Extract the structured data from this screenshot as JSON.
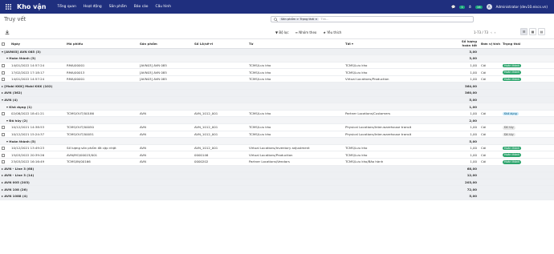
{
  "topbar": {
    "app_name": "Kho vận",
    "menu": [
      "Tổng quan",
      "Hoạt động",
      "Sản phẩm",
      "Báo cáo",
      "Cấu hình"
    ],
    "chat_count": "1",
    "activity_count": "14",
    "user": "Administrator (dev10.eiscs.vn)"
  },
  "control": {
    "title": "Truy vết",
    "search_facet": "Sản phẩm > Trạng thái",
    "search_placeholder": "Tìm...",
    "filters_label": "Bộ lọc",
    "groupby_label": "Nhóm theo",
    "favorites_label": "Yêu thích",
    "pager": "1-73 / 73"
  },
  "columns": [
    "Ngày",
    "Mã phiếu",
    "Sản phẩm",
    "Số Lô/sê-ri",
    "Từ",
    "Tới",
    "Số lượng hoàn tất",
    "Đơn vị tính",
    "Trạng thái"
  ],
  "rows": [
    {
      "kind": "g1",
      "label": "▾ [AVN03] AVN 085 (3)",
      "qty": "3,00"
    },
    {
      "kind": "g2",
      "label": "▾ Hoàn thành (3)",
      "qty": "3,00"
    },
    {
      "kind": "r",
      "date": "14/01/2022 14:57:24",
      "ref": "RMA/00001",
      "product": "[AVN03] AVN 085",
      "lot": "",
      "from": "TCMS/Lưu kho",
      "to": "TCMS/Lưu kho",
      "qty": "1,00",
      "uom": "Cái",
      "status": "Hoàn thành",
      "tone": "green"
    },
    {
      "kind": "r",
      "date": "17/02/2022 17:18:17",
      "ref": "RMA/00013",
      "product": "[AVN03] AVN 085",
      "lot": "",
      "from": "TCMS/Lưu kho",
      "to": "TCMS/Lưu kho",
      "qty": "1,00",
      "uom": "Cái",
      "status": "Hoàn thành",
      "tone": "green"
    },
    {
      "kind": "r",
      "date": "14/01/2022 14:57:24",
      "ref": "RMA/00001",
      "product": "[AVN03] AVN 085",
      "lot": "",
      "from": "TCMS/Lưu kho",
      "to": "Virtual Locations/Production",
      "qty": "1,00",
      "uom": "Cái",
      "status": "Hoàn thành",
      "tone": "green"
    },
    {
      "kind": "g1",
      "label": "▸ [Mobi KKK] Mobi KKK (102)",
      "qty": "364,00"
    },
    {
      "kind": "g1",
      "label": "▸ AVN (362)",
      "qty": "360,00"
    },
    {
      "kind": "g1",
      "label": "▾ AVN (4)",
      "qty": "5,00"
    },
    {
      "kind": "g2",
      "label": "▾ Khả dụng (1)",
      "qty": "1,00"
    },
    {
      "kind": "r",
      "date": "02/08/2022 18:41:21",
      "ref": "TCMS/OUT/00186",
      "product": "AVN",
      "lot": "AVN_1012_001",
      "from": "TCMS/Lưu kho",
      "to": "Partner Locations/Customers",
      "qty": "1,00",
      "uom": "Cái",
      "status": "Khả dụng",
      "tone": "blue"
    },
    {
      "kind": "g2",
      "label": "▾ Đã hủy (2)",
      "qty": "2,00"
    },
    {
      "kind": "r",
      "date": "10/12/2021 14:38:53",
      "ref": "TCMS/OUT/00050",
      "product": "AVN",
      "lot": "AVN_1012_001",
      "from": "TCMS/Lưu kho",
      "to": "Physical Locations/Inter-warehouse transit",
      "qty": "1,00",
      "uom": "Cái",
      "status": "Đã hủy",
      "tone": "grey"
    },
    {
      "kind": "r",
      "date": "10/12/2021 15:24:37",
      "ref": "TCMS/OUT/00051",
      "product": "AVN",
      "lot": "AVN_1012_001",
      "from": "TCMS/Lưu kho",
      "to": "Physical Locations/Inter-warehouse transit",
      "qty": "1,00",
      "uom": "Cái",
      "status": "Đã hủy",
      "tone": "grey"
    },
    {
      "kind": "g2",
      "label": "▾ Hoàn thành (5)",
      "qty": "5,00"
    },
    {
      "kind": "r",
      "date": "10/12/2021 13:49:23",
      "ref": "Số lượng sản phẩm đã cập nhật",
      "product": "AVN",
      "lot": "AVN_1012_001",
      "from": "Virtual Locations/Inventory adjustment",
      "to": "TCMS/Lưu kho",
      "qty": "1,00",
      "uom": "Cái",
      "status": "Hoàn thành",
      "tone": "green"
    },
    {
      "kind": "r",
      "date": "15/03/2022 20:39:26",
      "ref": "AVN/MO/00023/001",
      "product": "AVN",
      "lot": "0000146",
      "from": "Virtual Locations/Production",
      "to": "TCMS/Lưu kho",
      "qty": "1,00",
      "uom": "Cái",
      "status": "Hoàn thành",
      "tone": "green"
    },
    {
      "kind": "r",
      "date": "23/03/2022 16:16:49",
      "ref": "TCMS/IN/00166",
      "product": "AVN",
      "lot": "0000202",
      "from": "Partner Locations/Vendors",
      "to": "TCMS/Lưu kho/Bảo hành",
      "qty": "1,00",
      "uom": "Cái",
      "status": "Hoàn thành",
      "tone": "green"
    },
    {
      "kind": "g1",
      "label": "▸ AVN - Line 3 (68)",
      "qty": "68,00"
    },
    {
      "kind": "g1",
      "label": "▸ AVN - Line 3 (14)",
      "qty": "12,00"
    },
    {
      "kind": "g1",
      "label": "▸ AVN 005 (203)",
      "qty": "203,00"
    },
    {
      "kind": "g1",
      "label": "▸ AVN 108 (26)",
      "qty": "72,00"
    },
    {
      "kind": "g1",
      "label": "▸ AVN 1088 (4)",
      "qty": "5,00"
    }
  ]
}
